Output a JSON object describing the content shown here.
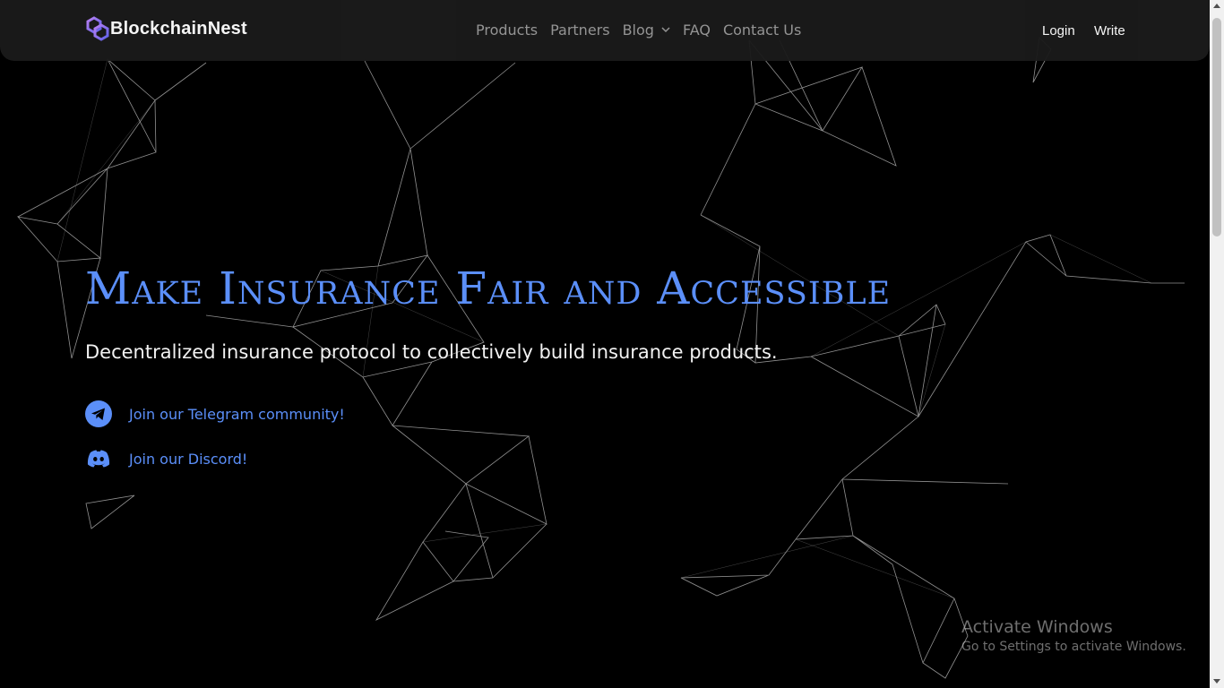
{
  "brand": {
    "name": "BlockchainNest",
    "accent": "#8b5cf6"
  },
  "nav": {
    "links": [
      "Products",
      "Partners",
      "Blog",
      "FAQ",
      "Contact Us"
    ],
    "login_label": "Login",
    "write_label": "Write"
  },
  "hero": {
    "title": "Make Insurance Fair and Accessible",
    "subtitle": "Decentralized insurance protocol to collectively build insurance products.",
    "color": "#5b8ff9"
  },
  "social": {
    "telegram": {
      "label": "Join our Telegram community!",
      "icon": "telegram-icon"
    },
    "discord": {
      "label": "Join our Discord!",
      "icon": "discord-icon"
    }
  },
  "watermark": {
    "title": "Activate Windows",
    "subtitle": "Go to Settings to activate Windows."
  }
}
